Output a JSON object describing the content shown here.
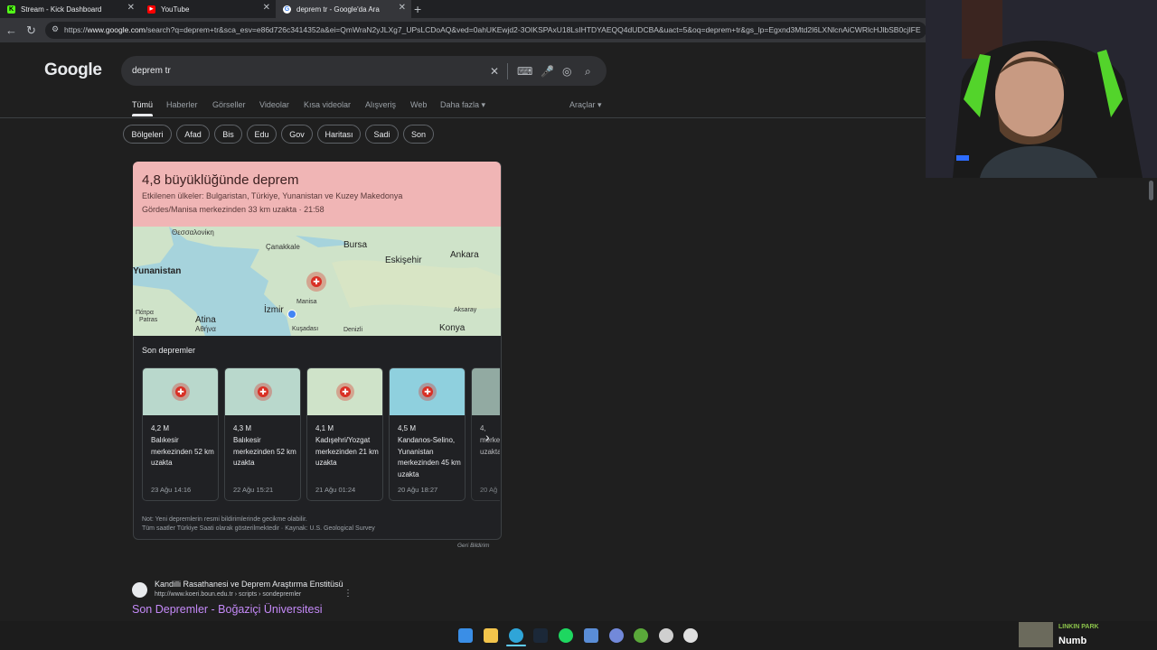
{
  "browser": {
    "tabs": [
      {
        "title": "Stream - Kick Dashboard",
        "icon": "kick-icon",
        "color": "#53fc18",
        "glyph": "K"
      },
      {
        "title": "YouTube",
        "icon": "youtube-icon",
        "color": "#ff0000",
        "glyph": "▶"
      },
      {
        "title": "deprem tr - Google'da Ara",
        "icon": "google-icon",
        "color": "#ffffff",
        "glyph": "G"
      }
    ],
    "url_prefix": "https://",
    "url_host": "www.google.com",
    "url_rest": "/search?q=deprem+tr&sca_esv=e86d726c3414352a&ei=QmWraN2yJLXg7_UPsLCDoAQ&ved=0ahUKEwjd2-3OIKSPAxU18LsIHTDYAEQQ4dUDCBA&uact=5&oq=deprem+tr&gs_lp=Egxnd3Mtd2l6LXNlcnAiCWRlcHJlbSB0cjIFE"
  },
  "search": {
    "logo": "Google",
    "query": "deprem tr",
    "tabs": [
      "Tümü",
      "Haberler",
      "Görseller",
      "Videolar",
      "Kısa videolar",
      "Alışveriş",
      "Web",
      "Daha fazla ▾"
    ],
    "tools": "Araçlar ▾",
    "chips": [
      "Bölgeleri",
      "Afad",
      "Bis",
      "Edu",
      "Gov",
      "Haritası",
      "Sadi",
      "Son"
    ]
  },
  "quake": {
    "title": "4,8 büyüklüğünde deprem",
    "affected": "Etkilenen ülkeler: Bulgaristan, Türkiye, Yunanistan ve Kuzey Makedonya",
    "location": "Gördes/Manisa merkezinden 33 km uzakta · 21:58",
    "map_labels": {
      "thessaloniki": "Θεσσαλονίκη",
      "canakkale": "Çanakkale",
      "bursa": "Bursa",
      "eskisehir": "Eskişehir",
      "ankara": "Ankara",
      "yunanistan": "Yunanistan",
      "manisa": "Manisa",
      "izmir": "İzmir",
      "aksaray": "Aksaray",
      "patras": "Πάτρα",
      "patras_latin": "Patras",
      "atina": "Atina",
      "athina": "Αθήνα",
      "kusadasi": "Kuşadası",
      "denizli": "Denizli",
      "konya": "Konya"
    },
    "recent_title": "Son depremler",
    "recent": [
      {
        "mag": "4,2 M",
        "desc": "Balıkesir merkezinden 52 km uzakta",
        "date": "23 Ağu 14:16"
      },
      {
        "mag": "4,3 M",
        "desc": "Balıkesir merkezinden 52 km uzakta",
        "date": "22 Ağu 15:21"
      },
      {
        "mag": "4,1 M",
        "desc": "Kadışehri/Yozgat merkezinden 21 km uzakta",
        "date": "21 Ağu 01:24"
      },
      {
        "mag": "4,5 M",
        "desc": "Kandanos-Selino, Yunanistan merkezinden 45 km uzakta",
        "date": "20 Ağu 18:27"
      },
      {
        "mag": "4,",
        "desc": "merkezinden km uzakta",
        "date": "20 Ağ"
      }
    ],
    "note1": "Not: Yeni depremlerin resmi bildirimlerinde gecikme olabilir.",
    "note2": "Tüm saatler Türkiye Saati olarak gösterilmektedir · Kaynak: U.S. Geological Survey",
    "feedback": "Geri Bildirim"
  },
  "result": {
    "site": "Kandilli Rasathanesi ve Deprem Araştırma Enstitüsü",
    "url": "http://www.koeri.boun.edu.tr › scripts › sondepremler",
    "title": "Son Depremler - Boğaziçi Üniversitesi"
  },
  "music": {
    "artist": "LINKIN PARK",
    "song": "Numb"
  },
  "taskbar": [
    "windows-icon",
    "file-explorer-icon",
    "edge-icon",
    "steam-icon",
    "spotify-icon",
    "app-icon",
    "discord-icon",
    "xbox-icon",
    "obs-icon",
    "chrome-icon"
  ]
}
